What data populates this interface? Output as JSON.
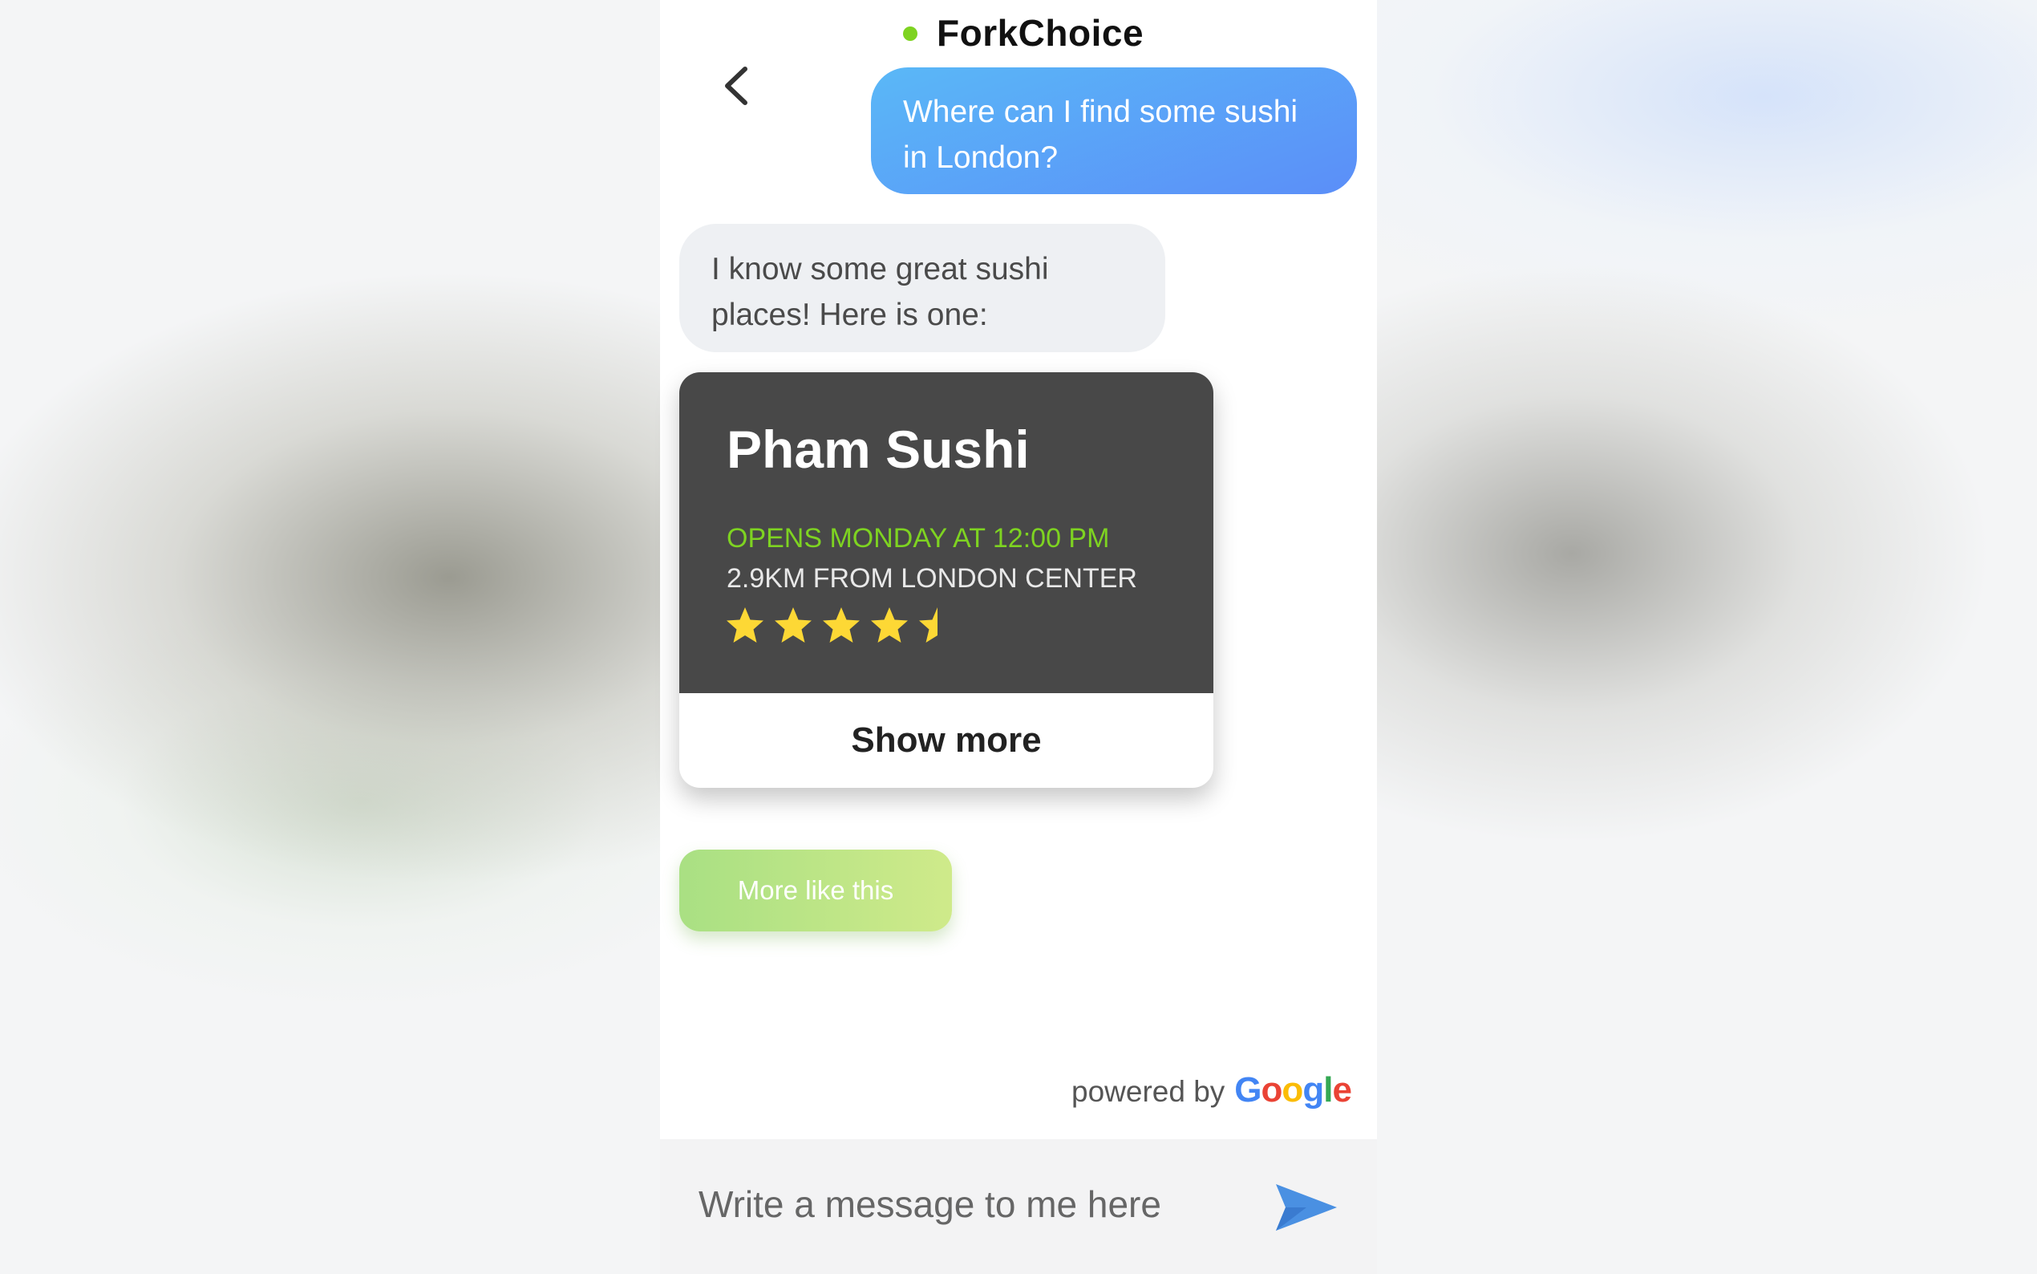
{
  "header": {
    "title": "ForkChoice",
    "status_color": "#7ed321"
  },
  "conversation": {
    "user_message": "Where can I find some sushi in London?",
    "bot_message": "I know some great sushi places! Here is one:"
  },
  "place_card": {
    "name": "Pham Sushi",
    "hours": "OPENS MONDAY AT 12:00 PM",
    "distance": "2.9KM FROM LONDON CENTER",
    "rating": 4.5,
    "rating_max": 5,
    "star_color": "#fdd835",
    "show_more_label": "Show more"
  },
  "actions": {
    "more_like_this_label": "More like this"
  },
  "attribution": {
    "powered_by": "powered by",
    "brand_letters": [
      "G",
      "o",
      "o",
      "g",
      "l",
      "e"
    ]
  },
  "composer": {
    "placeholder": "Write a message to me here",
    "send_icon": "send-icon",
    "send_color": "#4a90e2"
  },
  "colors": {
    "user_bubble_start": "#5ab8f7",
    "user_bubble_end": "#5b8ef8",
    "bot_bubble": "#eef0f3",
    "card_background": "#484848",
    "hours_text": "#7ed321",
    "more_like_this_start": "#a9e083",
    "more_like_this_end": "#cfea8a"
  }
}
